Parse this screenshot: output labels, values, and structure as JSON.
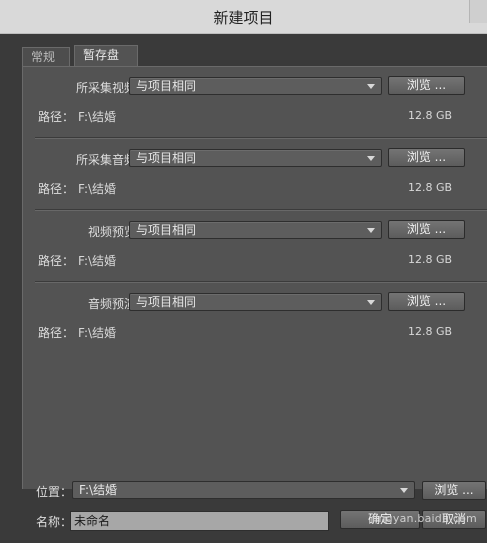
{
  "window": {
    "title": "新建项目"
  },
  "tabs": [
    {
      "label": "常规",
      "active": false
    },
    {
      "label": "暂存盘",
      "active": true
    }
  ],
  "sections": [
    {
      "label": "所采集视频：",
      "select": "与项目相同",
      "button": "浏览 ...",
      "path_label": "路径：",
      "path": "F:\\结婚",
      "size": "12.8 GB"
    },
    {
      "label": "所采集音频：",
      "select": "与项目相同",
      "button": "浏览 ...",
      "path_label": "路径：",
      "path": "F:\\结婚",
      "size": "12.8 GB"
    },
    {
      "label": "视频预览：",
      "select": "与项目相同",
      "button": "浏览 ...",
      "path_label": "路径：",
      "path": "F:\\结婚",
      "size": "12.8 GB"
    },
    {
      "label": "音频预演：",
      "select": "与项目相同",
      "button": "浏览 ...",
      "path_label": "路径：",
      "path": "F:\\结婚",
      "size": "12.8 GB"
    }
  ],
  "location": {
    "label": "位置：",
    "value": "F:\\结婚",
    "button": "浏览 ..."
  },
  "name": {
    "label": "名称：",
    "value": "未命名"
  },
  "footer": {
    "ok": "确定",
    "cancel": "取消"
  },
  "watermark": "jingyan.baidu.com"
}
